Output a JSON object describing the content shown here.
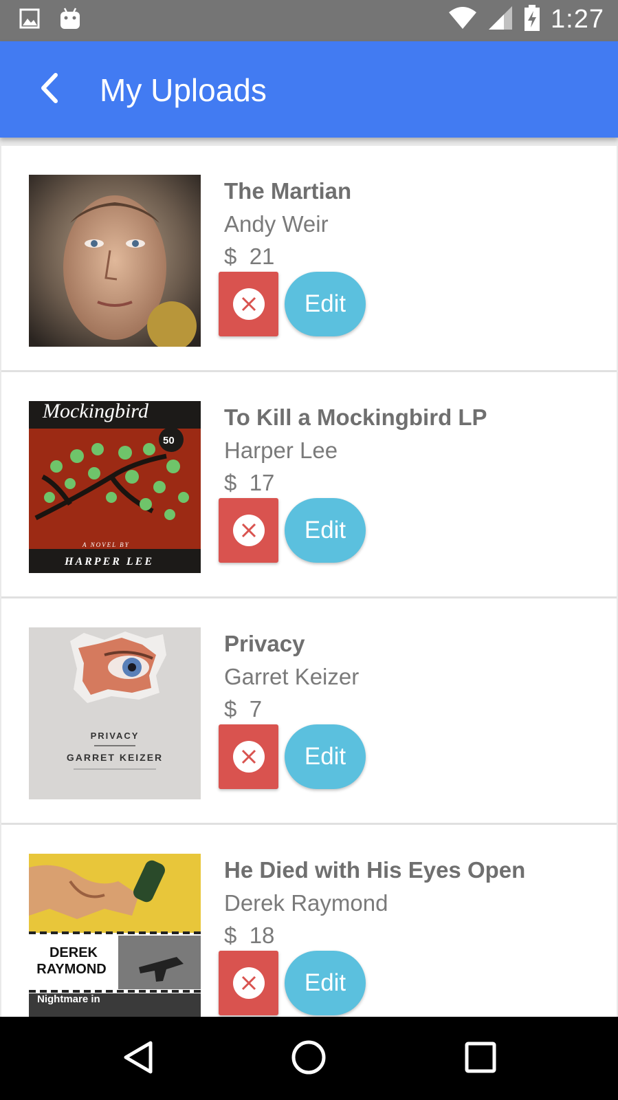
{
  "status_bar": {
    "time": "1:27",
    "left_icons": [
      "image-icon",
      "android-icon"
    ],
    "right_icons": [
      "wifi-icon",
      "signal-icon",
      "battery-charging-icon"
    ]
  },
  "app_bar": {
    "title": "My Uploads",
    "back_icon": "chevron-left-icon",
    "color": "#427bf2"
  },
  "uploads": [
    {
      "title": "The Martian",
      "author": "Andy Weir",
      "currency": "$",
      "price": "21",
      "edit_label": "Edit",
      "delete_icon": "close-circle-icon"
    },
    {
      "title": "To Kill a Mockingbird LP",
      "author": "Harper Lee",
      "currency": "$",
      "price": "17",
      "edit_label": "Edit",
      "delete_icon": "close-circle-icon"
    },
    {
      "title": "Privacy",
      "author": "Garret Keizer",
      "currency": "$",
      "price": "7",
      "edit_label": "Edit",
      "delete_icon": "close-circle-icon"
    },
    {
      "title": "He Died with His Eyes Open",
      "author": "Derek Raymond",
      "currency": "$",
      "price": "18",
      "edit_label": "Edit",
      "delete_icon": "close-circle-icon"
    }
  ],
  "covers": {
    "mockingbird_title": "Mockingbird",
    "mockingbird_badge": "50",
    "mockingbird_byline": "A NOVEL BY",
    "mockingbird_author": "HARPER LEE",
    "privacy_title": "PRIVACY",
    "privacy_author": "GARRET KEIZER",
    "raymond_author_line1": "DEREK",
    "raymond_author_line2": "RAYMOND",
    "raymond_subtitle": "Nightmare in"
  },
  "colors": {
    "delete_button": "#d9534f",
    "edit_button": "#5bc0de",
    "status_bar": "#757575",
    "text_muted": "#7a7a7a"
  },
  "nav_bar": {
    "buttons": [
      "back-triangle-icon",
      "home-circle-icon",
      "recents-square-icon"
    ]
  }
}
